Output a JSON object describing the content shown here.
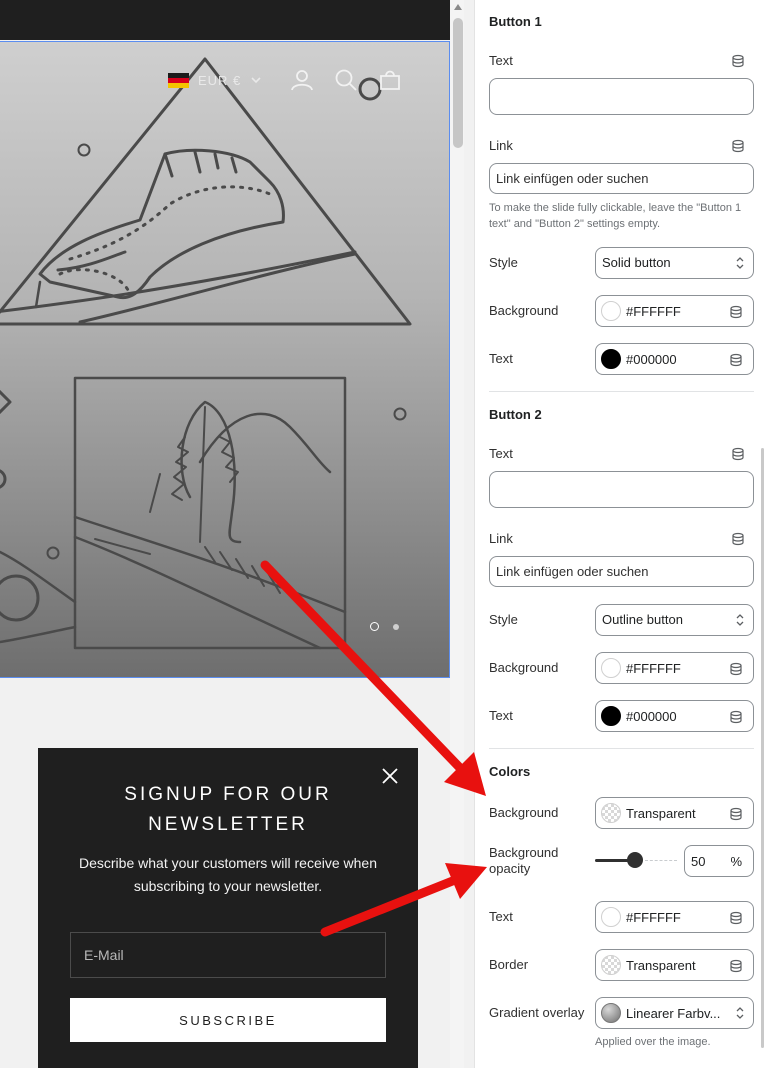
{
  "preview": {
    "currency": "EUR €",
    "icons": [
      "account-icon",
      "search-icon",
      "cart-icon"
    ],
    "slide_count": 2,
    "active_slide": 1
  },
  "popup": {
    "title_line1": "SIGNUP FOR OUR",
    "title_line2": "NEWSLETTER",
    "description": "Describe what your customers will receive when subscribing to your newsletter.",
    "email_placeholder": "E-Mail",
    "subscribe_label": "SUBSCRIBE"
  },
  "panel": {
    "button1": {
      "title": "Button 1",
      "text_label": "Text",
      "text_value": "",
      "link_label": "Link",
      "link_placeholder": "Link einfügen oder suchen",
      "hint": "To make the slide fully clickable, leave the \"Button 1 text\" and \"Button 2\" settings empty.",
      "style_label": "Style",
      "style_value": "Solid button",
      "background_label": "Background",
      "background_value": "#FFFFFF",
      "textcolor_label": "Text",
      "textcolor_value": "#000000"
    },
    "button2": {
      "title": "Button 2",
      "text_label": "Text",
      "text_value": "",
      "link_label": "Link",
      "link_placeholder": "Link einfügen oder suchen",
      "style_label": "Style",
      "style_value": "Outline button",
      "background_label": "Background",
      "background_value": "#FFFFFF",
      "textcolor_label": "Text",
      "textcolor_value": "#000000"
    },
    "colors": {
      "title": "Colors",
      "background_label": "Background",
      "background_value": "Transparent",
      "opacity_label_line1": "Background",
      "opacity_label_line2": "opacity",
      "opacity_value": "50",
      "opacity_unit": "%",
      "opacity_fraction": 0.5,
      "text_label": "Text",
      "text_value": "#FFFFFF",
      "border_label": "Border",
      "border_value": "Transparent",
      "gradient_label": "Gradient overlay",
      "gradient_value": "Linearer Farbv...",
      "gradient_hint": "Applied over the image."
    }
  },
  "theme": {
    "accent_red": "#e8110f",
    "selection_blue": "#5b8def",
    "dark": "#1f1f1f"
  }
}
